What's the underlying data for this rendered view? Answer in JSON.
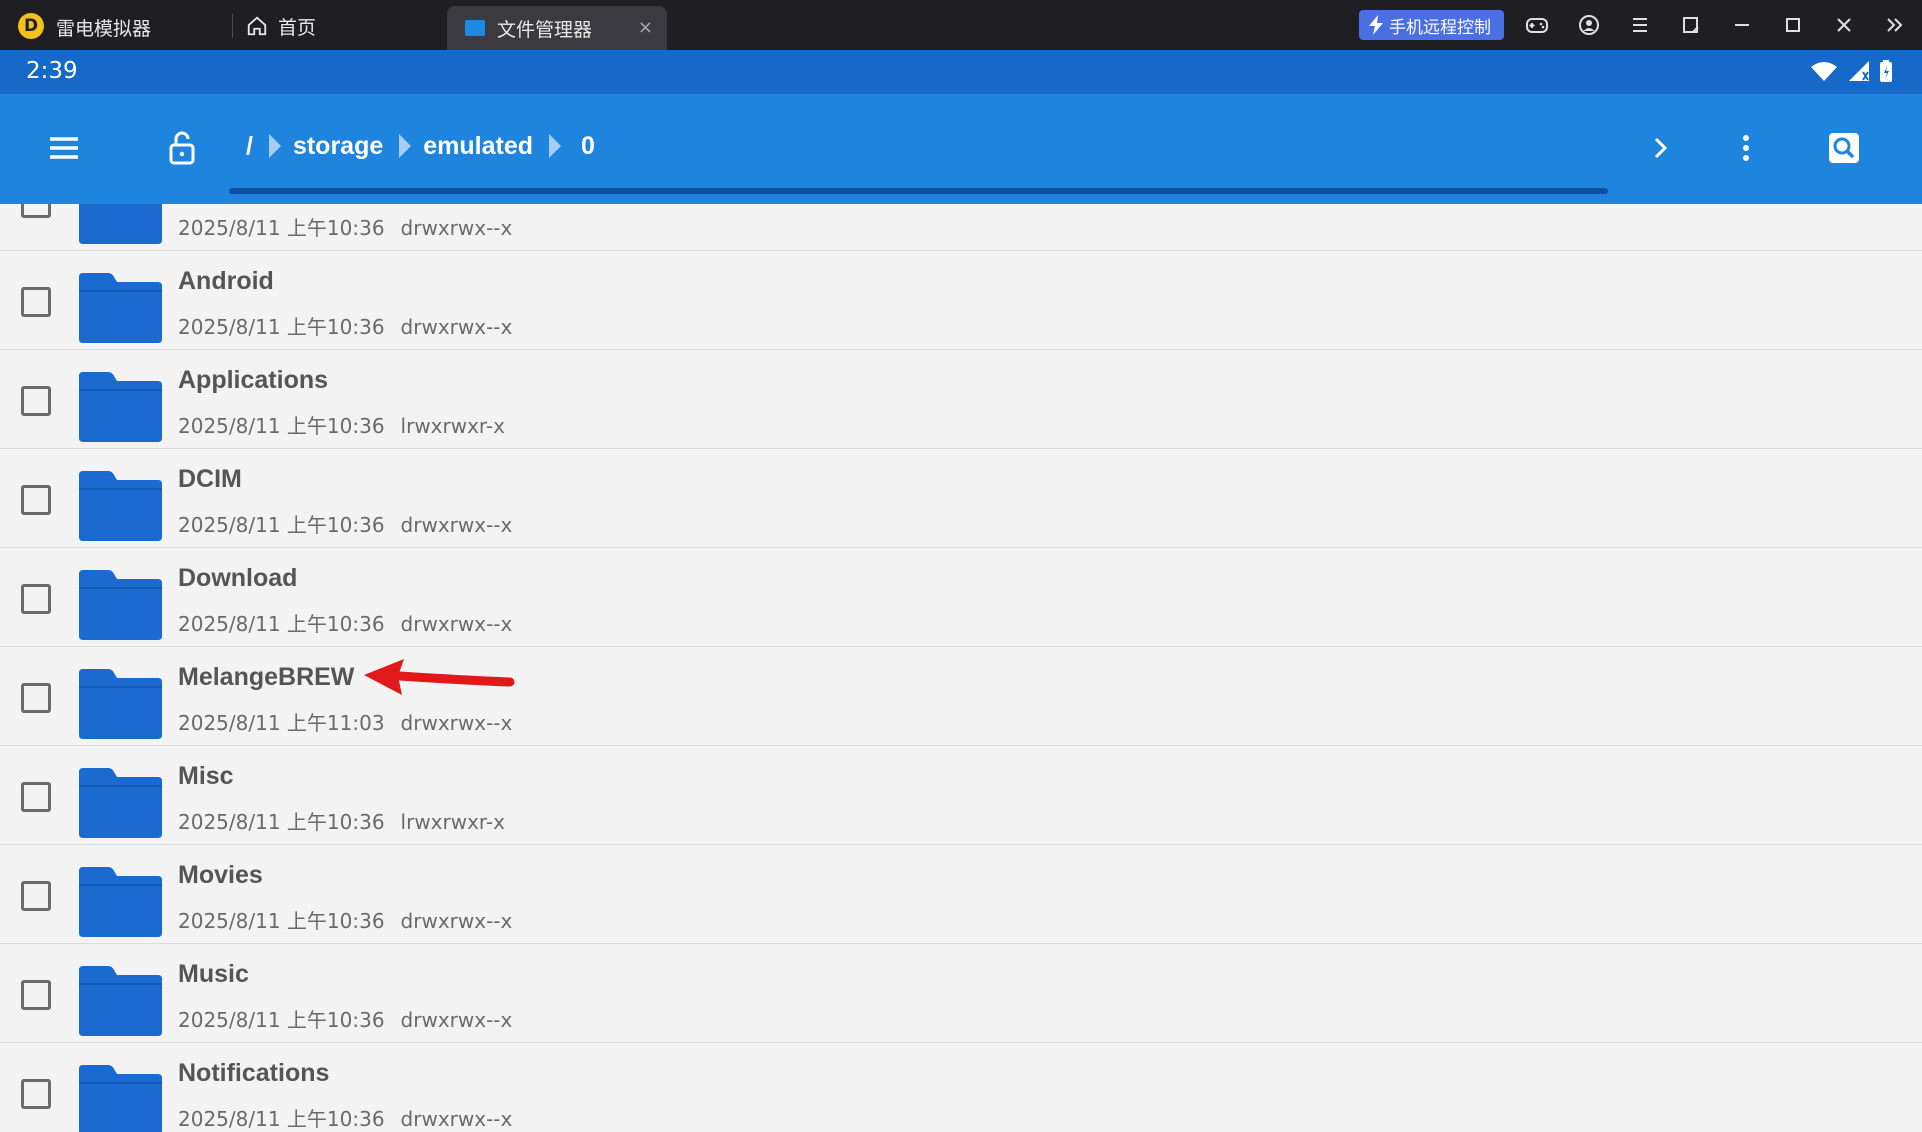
{
  "window": {
    "app_name": "雷电模拟器",
    "tabs": [
      {
        "label": "首页"
      },
      {
        "label": "文件管理器",
        "close": "×"
      }
    ],
    "remote_control_label": "手机远程控制"
  },
  "status_bar": {
    "time": "2:39"
  },
  "toolbar": {
    "breadcrumb": [
      "/",
      "storage",
      "emulated",
      "0"
    ]
  },
  "files": [
    {
      "name": "",
      "date": "2025/8/11 上午10:36",
      "perm": "drwxrwx--x"
    },
    {
      "name": "Android",
      "date": "2025/8/11 上午10:36",
      "perm": "drwxrwx--x"
    },
    {
      "name": "Applications",
      "date": "2025/8/11 上午10:36",
      "perm": "lrwxrwxr-x"
    },
    {
      "name": "DCIM",
      "date": "2025/8/11 上午10:36",
      "perm": "drwxrwx--x"
    },
    {
      "name": "Download",
      "date": "2025/8/11 上午10:36",
      "perm": "drwxrwx--x"
    },
    {
      "name": "MelangeBREW",
      "date": "2025/8/11 上午11:03",
      "perm": "drwxrwx--x"
    },
    {
      "name": "Misc",
      "date": "2025/8/11 上午10:36",
      "perm": "lrwxrwxr-x"
    },
    {
      "name": "Movies",
      "date": "2025/8/11 上午10:36",
      "perm": "drwxrwx--x"
    },
    {
      "name": "Music",
      "date": "2025/8/11 上午10:36",
      "perm": "drwxrwx--x"
    },
    {
      "name": "Notifications",
      "date": "2025/8/11 上午10:36",
      "perm": "drwxrwx--x"
    }
  ],
  "colors": {
    "titlebar": "#1f1f23",
    "statusbar": "#1669c9",
    "toolbar": "#1e84de",
    "folder": "#1a6ad0",
    "annotation_arrow": "#e01a1a",
    "remote_button": "#4a6fe3"
  }
}
